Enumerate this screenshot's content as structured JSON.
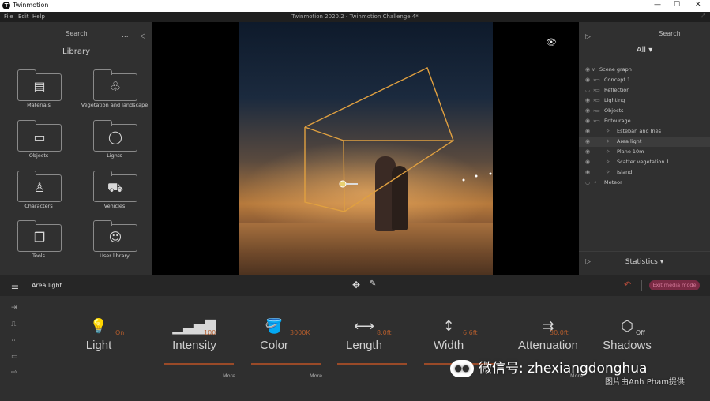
{
  "window": {
    "app_name": "Twinmotion",
    "doc_title": "Twinmotion 2020.2 - Twinmotion Challenge 4*",
    "minimize": "—",
    "maximize": "☐",
    "close": "✕"
  },
  "menu": {
    "file": "File",
    "edit": "Edit",
    "help": "Help"
  },
  "library": {
    "search_label": "Search",
    "title": "Library",
    "more": "...",
    "collapse": "◁",
    "items": [
      {
        "label": "Materials",
        "icon": "fan-icon"
      },
      {
        "label": "Vegetation and landscape",
        "icon": "tree-icon"
      },
      {
        "label": "Objects",
        "icon": "sofa-icon"
      },
      {
        "label": "Lights",
        "icon": "bulb-icon"
      },
      {
        "label": "Characters",
        "icon": "person-icon"
      },
      {
        "label": "Vehicles",
        "icon": "car-icon"
      },
      {
        "label": "Tools",
        "icon": "cubes-icon"
      },
      {
        "label": "User library",
        "icon": "user-icon"
      }
    ]
  },
  "scene_panel": {
    "search_label": "Search",
    "filter": "All ▾",
    "tree": [
      {
        "label": "Scene graph",
        "level": 0,
        "selected": false
      },
      {
        "label": "Concept 1",
        "level": 1,
        "selected": false
      },
      {
        "label": "Reflection",
        "level": 1,
        "selected": false
      },
      {
        "label": "Lighting",
        "level": 1,
        "selected": false
      },
      {
        "label": "Objects",
        "level": 1,
        "selected": false
      },
      {
        "label": "Entourage",
        "level": 1,
        "selected": false
      },
      {
        "label": "Esteban and Ines",
        "level": 2,
        "selected": false
      },
      {
        "label": "Area light",
        "level": 2,
        "selected": true
      },
      {
        "label": "Plane 10m",
        "level": 2,
        "selected": false
      },
      {
        "label": "Scatter vegetation 1",
        "level": 2,
        "selected": false
      },
      {
        "label": "Island",
        "level": 2,
        "selected": false
      },
      {
        "label": "Meteor",
        "level": 1,
        "selected": false
      }
    ],
    "statistics": "Statistics ▾"
  },
  "toolbar": {
    "selected_object": "Area light",
    "exit_button": "Exit media mode"
  },
  "properties": [
    {
      "name": "Light",
      "value": "On",
      "icon": "bulb-icon",
      "more": ""
    },
    {
      "name": "Intensity",
      "value": "100",
      "icon": "bars-icon",
      "more": "More"
    },
    {
      "name": "Color",
      "value": "3000K",
      "icon": "bucket-icon",
      "more": "More"
    },
    {
      "name": "Length",
      "value": "8.0ft",
      "icon": "length-icon",
      "more": ""
    },
    {
      "name": "Width",
      "value": "6.6ft",
      "icon": "width-icon",
      "more": ""
    },
    {
      "name": "Attenuation",
      "value": "30.0ft",
      "icon": "attenuation-icon",
      "more": "More"
    },
    {
      "name": "Shadows",
      "value": "Off",
      "icon": "cube-icon",
      "more": ""
    }
  ],
  "watermark": {
    "text": "微信号: zhexiangdonghua",
    "credit": "图片由Anh Pham提供"
  },
  "colors": {
    "accent": "#b25c2c",
    "exit": "#7a2a44",
    "lightbox": "#e0a040"
  }
}
